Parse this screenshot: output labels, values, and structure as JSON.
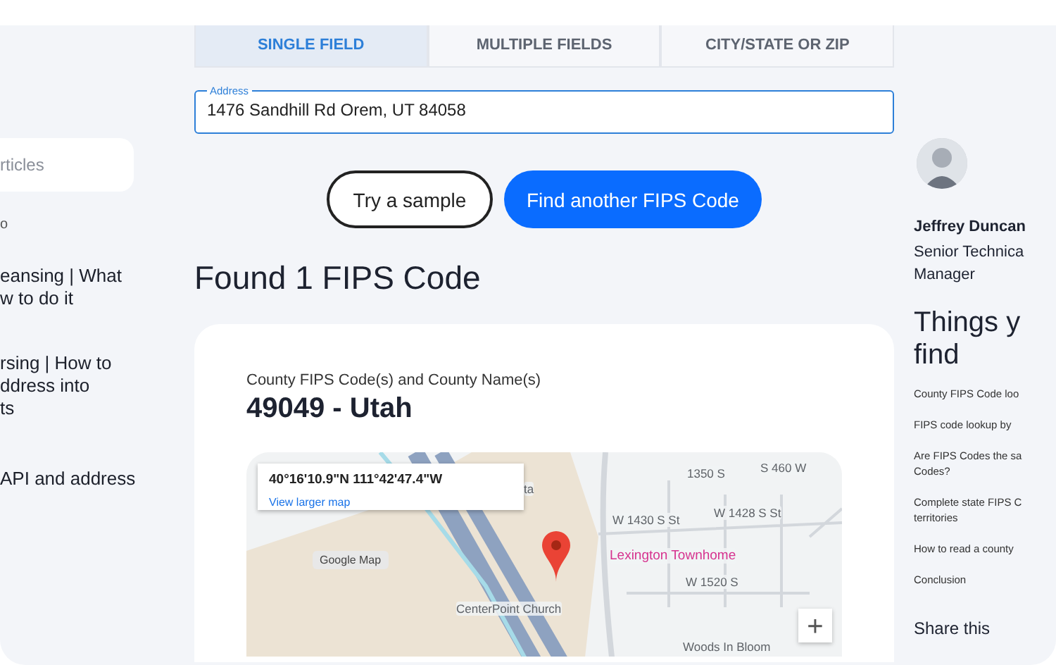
{
  "left_sidebar": {
    "search": {
      "placeholder": "rticles"
    },
    "items": [
      {
        "lines": [
          "o"
        ],
        "kind": "small"
      },
      {
        "lines": [
          "eansing | What",
          "w to do it"
        ],
        "kind": "link"
      },
      {
        "lines": [
          "rsing | How to",
          "ddress into",
          "ts"
        ],
        "kind": "link"
      },
      {
        "lines": [
          "API and address"
        ],
        "kind": "link"
      }
    ]
  },
  "tabs": [
    {
      "label": "SINGLE FIELD",
      "selected": true
    },
    {
      "label": "MULTIPLE FIELDS",
      "selected": false
    },
    {
      "label": "CITY/STATE OR ZIP",
      "selected": false
    }
  ],
  "address_field": {
    "label": "Address",
    "value": "1476 Sandhill Rd Orem, UT 84058"
  },
  "buttons": [
    {
      "label": "Try a sample",
      "kind": "outline"
    },
    {
      "label": "Find another FIPS Code",
      "kind": "primary"
    }
  ],
  "heading": "Found 1 FIPS Code",
  "result": {
    "label": "County FIPS Code(s) and County Name(s)",
    "value": "49049 - Utah"
  },
  "map": {
    "coordinates": "40°16'10.9\"N 111°42'47.4\"W",
    "link": "View larger map",
    "zoom_button": "+",
    "labels": [
      {
        "text": "ta",
        "kind": "road"
      },
      {
        "text": "1350 S",
        "kind": "road"
      },
      {
        "text": "S 460 W",
        "kind": "road"
      },
      {
        "text": "W 1430 S St",
        "kind": "road"
      },
      {
        "text": "W 1428 S St",
        "kind": "road"
      },
      {
        "text": "Lexington Townhome",
        "kind": "place"
      },
      {
        "text": "W 1520 S",
        "kind": "road"
      },
      {
        "text": "Google Map",
        "kind": "chip"
      },
      {
        "text": "CenterPoint Church",
        "kind": "road"
      },
      {
        "text": "Woods In Bloom",
        "kind": "road"
      }
    ]
  },
  "author": {
    "name": "Jeffrey Duncan",
    "title_lines": [
      "Senior Technica",
      "Manager"
    ]
  },
  "toc": {
    "heading_lines": [
      "Things y",
      "find"
    ],
    "items": [
      {
        "lines": [
          "County FIPS Code loo"
        ]
      },
      {
        "lines": [
          "FIPS code lookup by"
        ]
      },
      {
        "lines": [
          "Are FIPS Codes the sa",
          "Codes?"
        ]
      },
      {
        "lines": [
          "Complete state FIPS C",
          "territories"
        ]
      },
      {
        "lines": [
          "How to read a county"
        ]
      },
      {
        "lines": [
          "Conclusion"
        ]
      }
    ]
  },
  "share": "Share this"
}
